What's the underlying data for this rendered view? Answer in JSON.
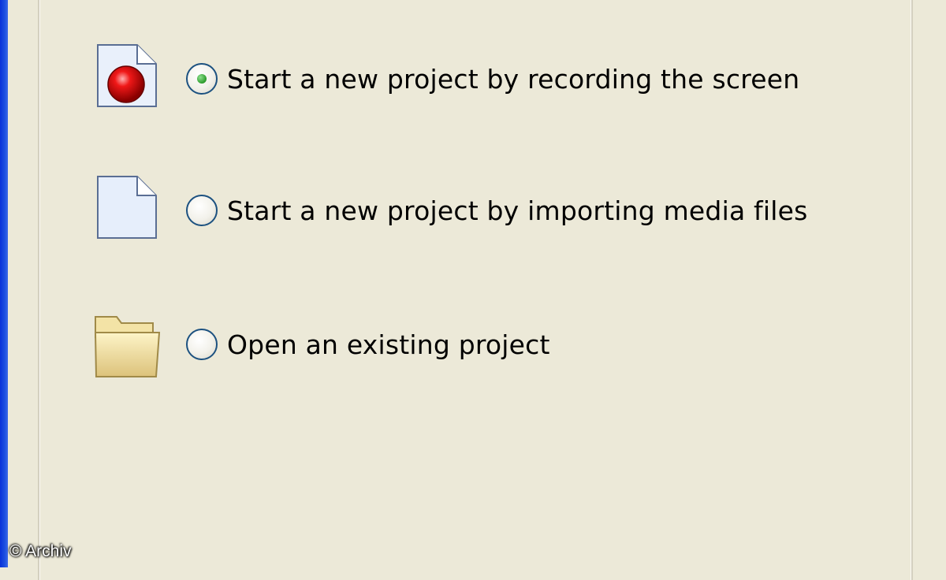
{
  "options": [
    {
      "label": "Start a new project by recording the screen",
      "selected": true,
      "icon": "record-document-icon"
    },
    {
      "label": "Start a new project by importing media files",
      "selected": false,
      "icon": "blank-document-icon"
    },
    {
      "label": "Open an existing project",
      "selected": false,
      "icon": "folder-icon"
    }
  ],
  "watermark": "© Archiv",
  "colors": {
    "background": "#ece9d8",
    "window_border": "#0831d9",
    "radio_border": "#1c5180",
    "radio_selected": "#2a9a2a",
    "record_dot": "#e00000"
  }
}
